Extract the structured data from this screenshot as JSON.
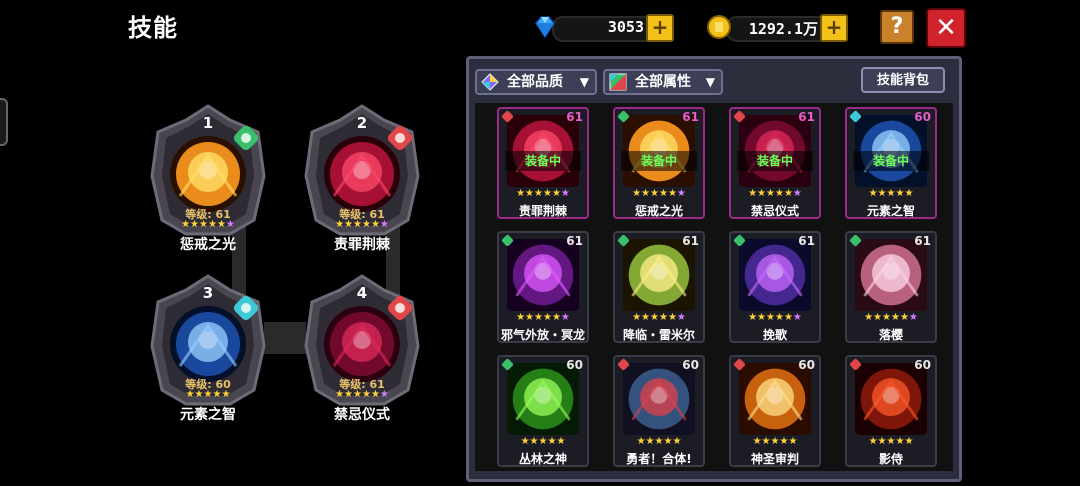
{
  "header": {
    "title": "技能"
  },
  "currency": {
    "gems": "3053",
    "gold": "1292.1万"
  },
  "buttons": {
    "help": "?",
    "close": "✕",
    "plus": "+"
  },
  "colors": {
    "gold": "#f2c21b",
    "close": "#d0232b",
    "help": "#c9812b",
    "equipped_text": "#6cff5a",
    "level_text": "#e8c16a"
  },
  "slots": [
    {
      "number": "1",
      "level_text": "等级: 61",
      "stars": "★★★★★",
      "extra_star": "★",
      "name": "惩戒之光",
      "element_color": "#38c06a",
      "art": "light",
      "element_icon": "leaf-element-icon"
    },
    {
      "number": "2",
      "level_text": "等级: 61",
      "stars": "★★★★★",
      "extra_star": "★",
      "name": "责罪荆棘",
      "element_color": "#e0464a",
      "art": "thorn",
      "element_icon": "fire-element-icon"
    },
    {
      "number": "3",
      "level_text": "等级: 60",
      "stars": "★★★★★",
      "extra_star": "",
      "name": "元素之智",
      "element_color": "#3ec8d8",
      "art": "element",
      "element_icon": "water-element-icon"
    },
    {
      "number": "4",
      "level_text": "等级: 61",
      "stars": "★★★★★",
      "extra_star": "★",
      "name": "禁忌仪式",
      "element_color": "#e0464a",
      "art": "ritual",
      "element_icon": "fire-element-icon"
    }
  ],
  "panel": {
    "quality_filter": "全部品质",
    "attribute_filter": "全部属性",
    "bag_button": "技能背包",
    "equipped_label": "装备中"
  },
  "cards": [
    {
      "name": "责罪荆棘",
      "level": "61",
      "stars": "★★★★★",
      "extra_star": "★",
      "equipped": true,
      "q_color": "#e0464a",
      "art": "thorn"
    },
    {
      "name": "惩戒之光",
      "level": "61",
      "stars": "★★★★★",
      "extra_star": "★",
      "equipped": true,
      "q_color": "#38c06a",
      "art": "light"
    },
    {
      "name": "禁忌仪式",
      "level": "61",
      "stars": "★★★★★",
      "extra_star": "★",
      "equipped": true,
      "q_color": "#e0464a",
      "art": "ritual"
    },
    {
      "name": "元素之智",
      "level": "60",
      "stars": "★★★★★",
      "extra_star": "",
      "equipped": true,
      "q_color": "#3ec8d8",
      "art": "element"
    },
    {
      "name": "邪气外放・冥龙",
      "level": "61",
      "stars": "★★★★★",
      "extra_star": "★",
      "equipped": false,
      "q_color": "#38c06a",
      "art": "dragon"
    },
    {
      "name": "降临・雷米尔",
      "level": "61",
      "stars": "★★★★★",
      "extra_star": "★",
      "equipped": false,
      "q_color": "#38c06a",
      "art": "remiel"
    },
    {
      "name": "挽歌",
      "level": "61",
      "stars": "★★★★★",
      "extra_star": "★",
      "equipped": false,
      "q_color": "#38c06a",
      "art": "elegy"
    },
    {
      "name": "落樱",
      "level": "61",
      "stars": "★★★★★",
      "extra_star": "★",
      "equipped": false,
      "q_color": "#38c06a",
      "art": "sakura"
    },
    {
      "name": "丛林之神",
      "level": "60",
      "stars": "★★★★★",
      "extra_star": "",
      "equipped": false,
      "q_color": "#38c06a",
      "art": "jungle"
    },
    {
      "name": "勇者！合体!",
      "level": "60",
      "stars": "★★★★★",
      "extra_star": "",
      "equipped": false,
      "q_color": "#e0464a",
      "art": "hero"
    },
    {
      "name": "神圣审判",
      "level": "60",
      "stars": "★★★★★",
      "extra_star": "",
      "equipped": false,
      "q_color": "#e0464a",
      "art": "judge"
    },
    {
      "name": "影侍",
      "level": "60",
      "stars": "★★★★★",
      "extra_star": "",
      "equipped": false,
      "q_color": "#e0464a",
      "art": "shadow"
    }
  ]
}
